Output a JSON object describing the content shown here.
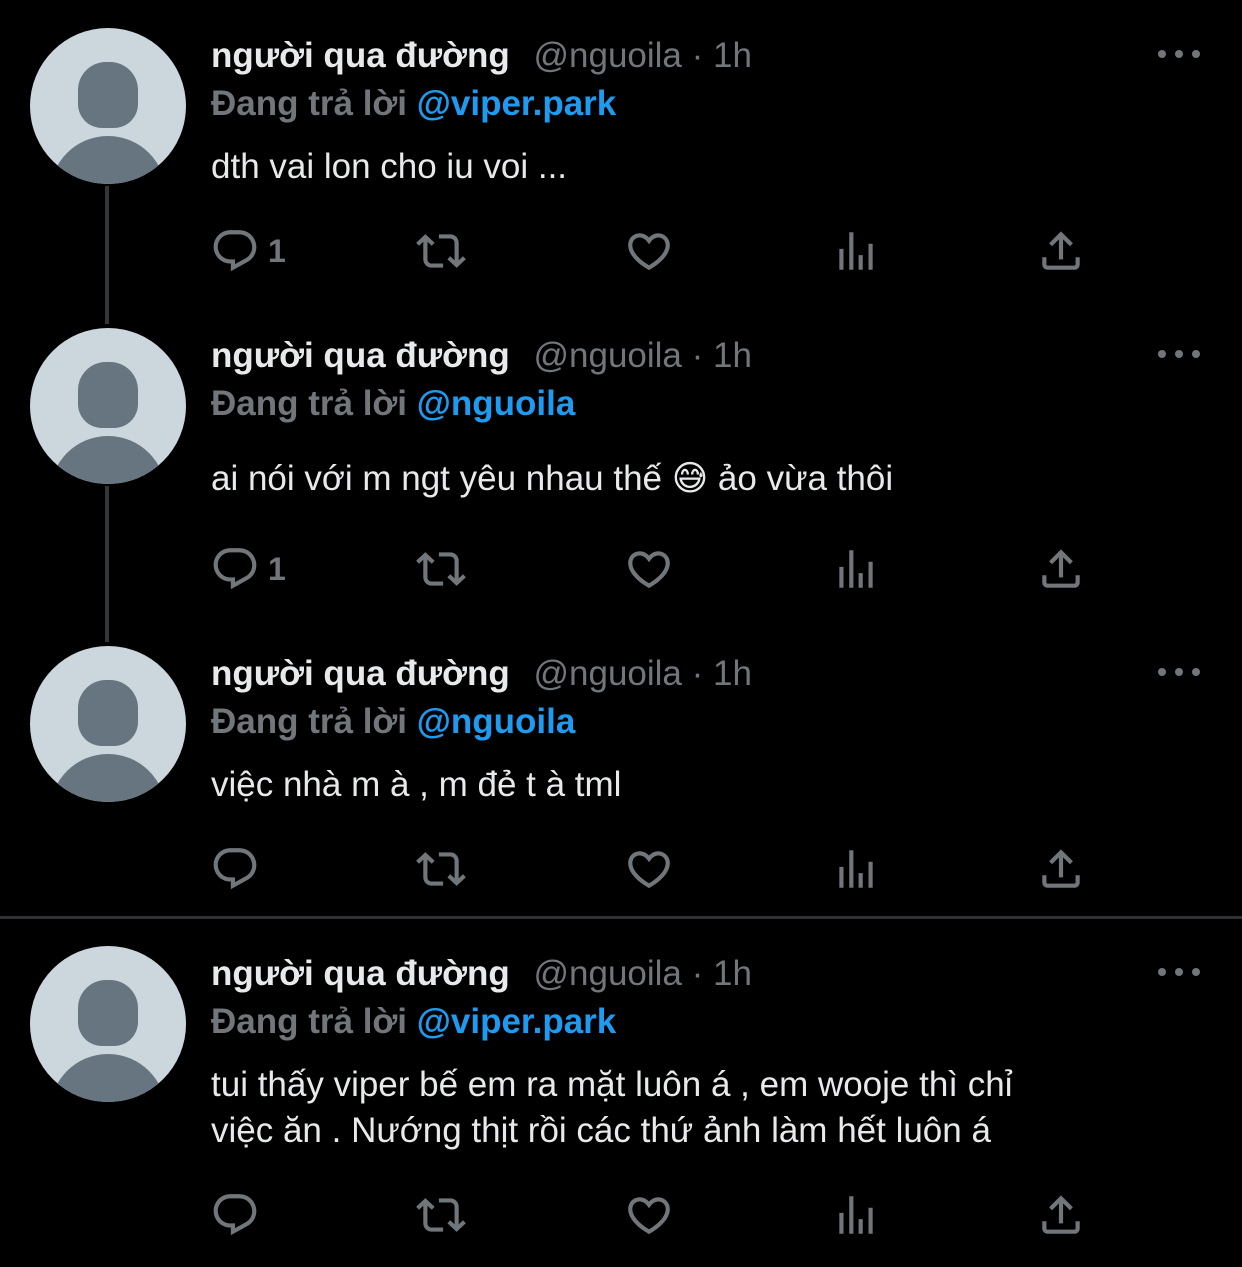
{
  "tweets": [
    {
      "name": "người qua đường",
      "handle": "@nguoila",
      "separator": "·",
      "time": "1h",
      "reply_prefix": "Đang trả lời",
      "reply_target": "@viper.park",
      "content": "dth vai lon cho iu voi ...",
      "reply_count": "1"
    },
    {
      "name": "người qua đường",
      "handle": "@nguoila",
      "separator": "·",
      "time": "1h",
      "reply_prefix": "Đang trả lời",
      "reply_target": "@nguoila",
      "content": "ai nói với m ngt yêu nhau thế 😅  ảo vừa thôi",
      "reply_count": "1"
    },
    {
      "name": "người qua đường",
      "handle": "@nguoila",
      "separator": "·",
      "time": "1h",
      "reply_prefix": "Đang trả lời",
      "reply_target": "@nguoila",
      "content": "việc nhà m à , m đẻ t à tml",
      "reply_count": ""
    },
    {
      "name": "người qua đường",
      "handle": "@nguoila",
      "separator": "·",
      "time": "1h",
      "reply_prefix": "Đang trả lời",
      "reply_target": "@viper.park",
      "content_line1": "tui thấy viper bế em ra mặt luôn á , em wooje thì chỉ",
      "content_line2": "việc ăn . Nướng thịt rồi các thứ ảnh làm hết luôn á",
      "reply_count": ""
    }
  ],
  "colors": {
    "background": "#000000",
    "text": "#e7e9ea",
    "secondary": "#71767b",
    "link": "#1d9bf0",
    "divider": "#2f3336"
  },
  "icons": [
    "reply-icon",
    "retweet-icon",
    "like-icon",
    "analytics-icon",
    "share-icon",
    "more-icon",
    "avatar-placeholder"
  ]
}
